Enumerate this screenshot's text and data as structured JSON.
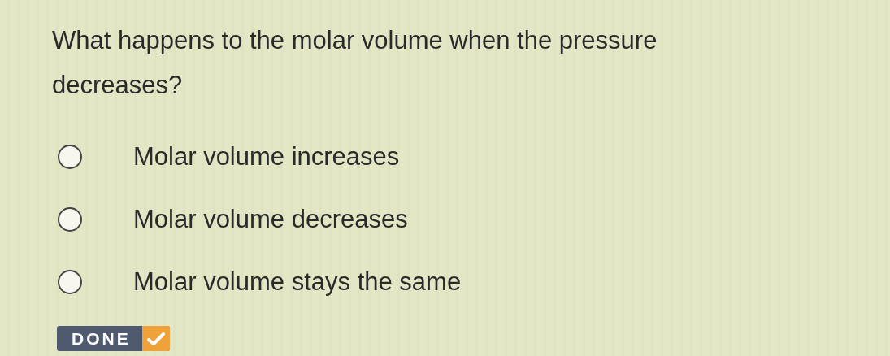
{
  "question": "What happens to the molar volume when the pressure decreases?",
  "options": [
    {
      "label": "Molar volume increases",
      "selected": false
    },
    {
      "label": "Molar volume decreases",
      "selected": false
    },
    {
      "label": "Molar volume stays the same",
      "selected": false
    }
  ],
  "done_button": {
    "label": "DONE"
  }
}
